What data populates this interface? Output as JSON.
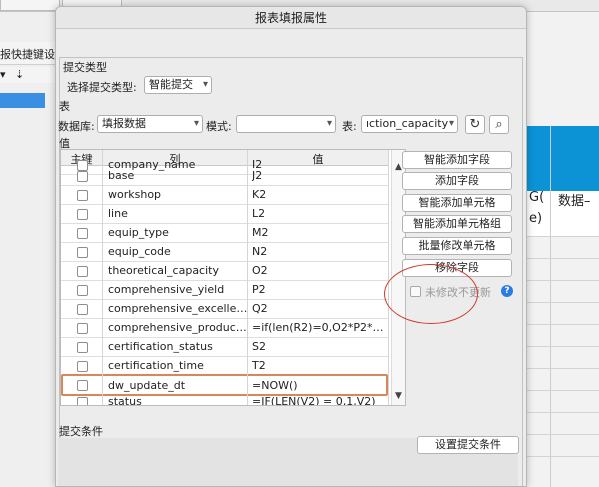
{
  "dialog": {
    "title": "报表填报属性"
  },
  "background": {
    "left_tab_label": "报快捷键设置",
    "right_header_text_1": "G(",
    "right_header_text_2": "数据–",
    "right_header_text_3": "e)"
  },
  "submit_type": {
    "section_label": "提交类型",
    "select_label": "选择提交类型:",
    "selected": "智能提交"
  },
  "table_section": {
    "section_label": "表",
    "db_label": "数据库:",
    "db_value": "填报数据",
    "mode_label": "模式:",
    "mode_value": "",
    "table_label": "表:",
    "table_value": "ıction_capacity"
  },
  "values": {
    "section_label": "值",
    "headers": [
      "主键",
      "列",
      "值"
    ],
    "rows": [
      {
        "name": "company_name",
        "value": "I2"
      },
      {
        "name": "base",
        "value": "J2"
      },
      {
        "name": "workshop",
        "value": "K2"
      },
      {
        "name": "line",
        "value": "L2"
      },
      {
        "name": "equip_type",
        "value": "M2"
      },
      {
        "name": "equip_code",
        "value": "N2"
      },
      {
        "name": "theoretical_capacity",
        "value": "O2"
      },
      {
        "name": "comprehensive_yield",
        "value": "P2"
      },
      {
        "name": "comprehensive_excellen...",
        "value": "Q2"
      },
      {
        "name": "comprehensive_producti...",
        "value": "=if(len(R2)=0,O2*P2*Q..."
      },
      {
        "name": "certification_status",
        "value": "S2"
      },
      {
        "name": "certification_time",
        "value": "T2"
      },
      {
        "name": "dw_update_dt",
        "value": "=NOW()"
      },
      {
        "name": "status",
        "value": "=IF(LEN(V2) = 0,1,V2)"
      }
    ]
  },
  "side_buttons": {
    "smart_add_field": "智能添加字段",
    "add_field": "添加字段",
    "smart_add_cell": "智能添加单元格",
    "smart_add_cell_group": "智能添加单元格组",
    "batch_modify_cell": "批量修改单元格",
    "remove_field": "移除字段",
    "no_update_unchanged": "未修改不更新"
  },
  "submit_condition": {
    "section_label": "提交条件",
    "set_button": "设置提交条件"
  },
  "colors": {
    "highlight_border": "#d9875a",
    "annotation_ellipse": "#d23b2f",
    "selection_blue": "#3b8fe3",
    "header_blue": "#0b93d6",
    "help_blue": "#2c7be5"
  }
}
